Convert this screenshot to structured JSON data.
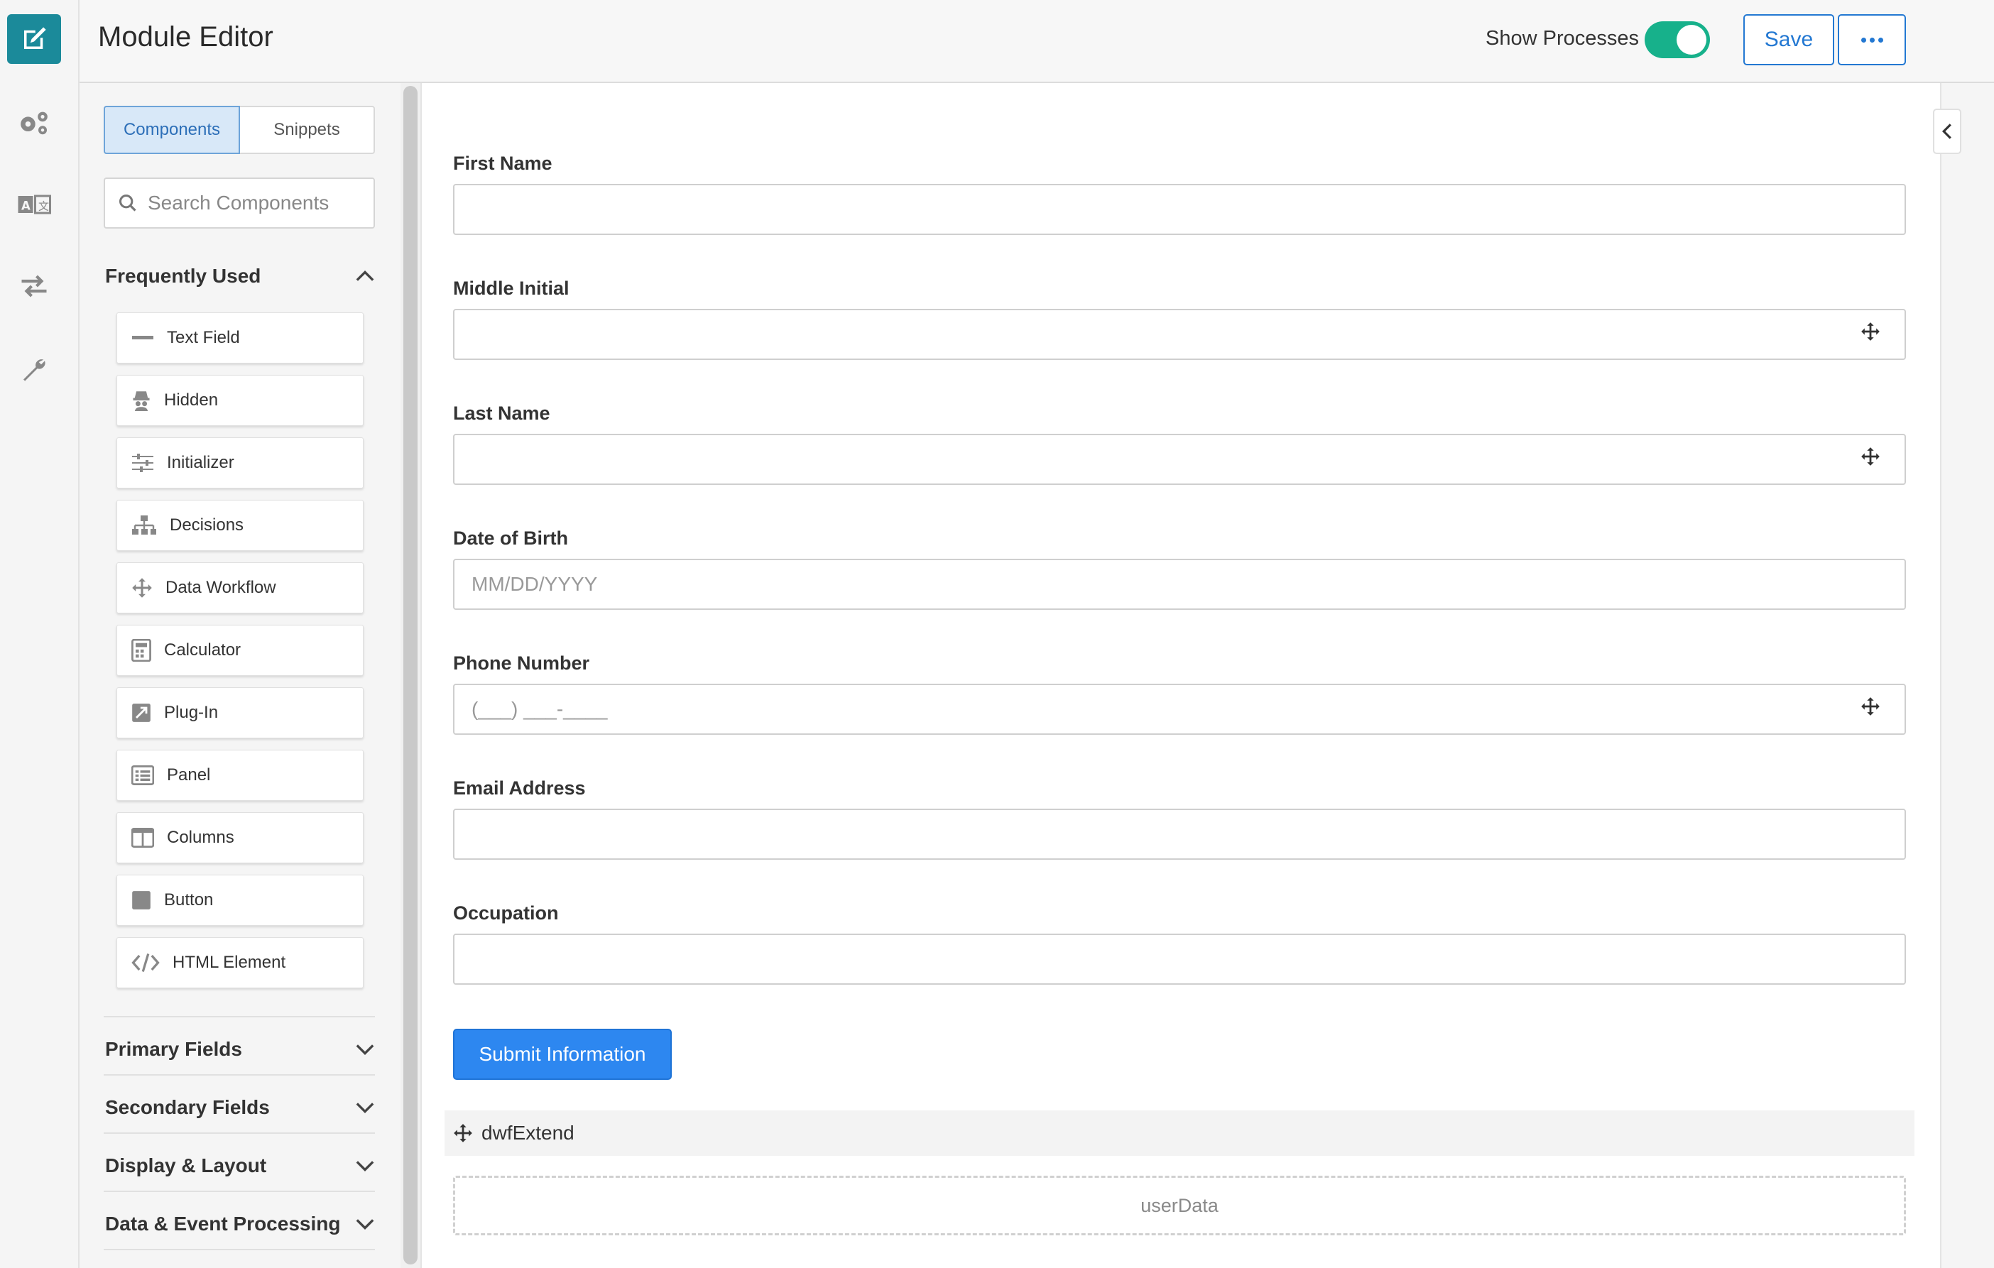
{
  "header": {
    "title": "Module Editor",
    "show_processes_label": "Show Processes",
    "show_processes_on": true,
    "save_label": "Save"
  },
  "rail": {
    "items": [
      {
        "icon": "edit-icon",
        "active": true
      },
      {
        "icon": "gears-icon",
        "active": false
      },
      {
        "icon": "translate-icon",
        "active": false
      },
      {
        "icon": "transfer-arrows-icon",
        "active": false
      },
      {
        "icon": "wrench-icon",
        "active": false
      }
    ]
  },
  "sidebar": {
    "tabs": {
      "components": "Components",
      "snippets": "Snippets"
    },
    "search_placeholder": "Search Components",
    "frequently_used": {
      "title": "Frequently Used",
      "items": [
        {
          "label": "Text Field",
          "icon": "text-field-icon"
        },
        {
          "label": "Hidden",
          "icon": "hidden-spy-icon"
        },
        {
          "label": "Initializer",
          "icon": "sliders-icon"
        },
        {
          "label": "Decisions",
          "icon": "sitemap-icon"
        },
        {
          "label": "Data Workflow",
          "icon": "move-arrows-icon"
        },
        {
          "label": "Calculator",
          "icon": "calculator-icon"
        },
        {
          "label": "Plug-In",
          "icon": "plugin-image-icon"
        },
        {
          "label": "Panel",
          "icon": "panel-list-icon"
        },
        {
          "label": "Columns",
          "icon": "columns-icon"
        },
        {
          "label": "Button",
          "icon": "button-square-icon"
        },
        {
          "label": "HTML Element",
          "icon": "code-icon"
        }
      ]
    },
    "groups": [
      "Primary Fields",
      "Secondary Fields",
      "Display & Layout",
      "Data & Event Processing"
    ]
  },
  "form": {
    "fields": [
      {
        "label": "First Name",
        "placeholder": "",
        "handle": false
      },
      {
        "label": "Middle Initial",
        "placeholder": "",
        "handle": true
      },
      {
        "label": "Last Name",
        "placeholder": "",
        "handle": true
      },
      {
        "label": "Date of Birth",
        "placeholder": "MM/DD/YYYY",
        "handle": false
      },
      {
        "label": "Phone Number",
        "placeholder": "(___) ___-____",
        "handle": true
      },
      {
        "label": "Email Address",
        "placeholder": "",
        "handle": false
      },
      {
        "label": "Occupation",
        "placeholder": "",
        "handle": false
      }
    ],
    "submit_label": "Submit Information",
    "dwf_label": "dwfExtend",
    "dropzone_label": "userData"
  },
  "colors": {
    "accent": "#1b8a9a",
    "primary": "#2d87f0",
    "toggle": "#17b18b"
  }
}
